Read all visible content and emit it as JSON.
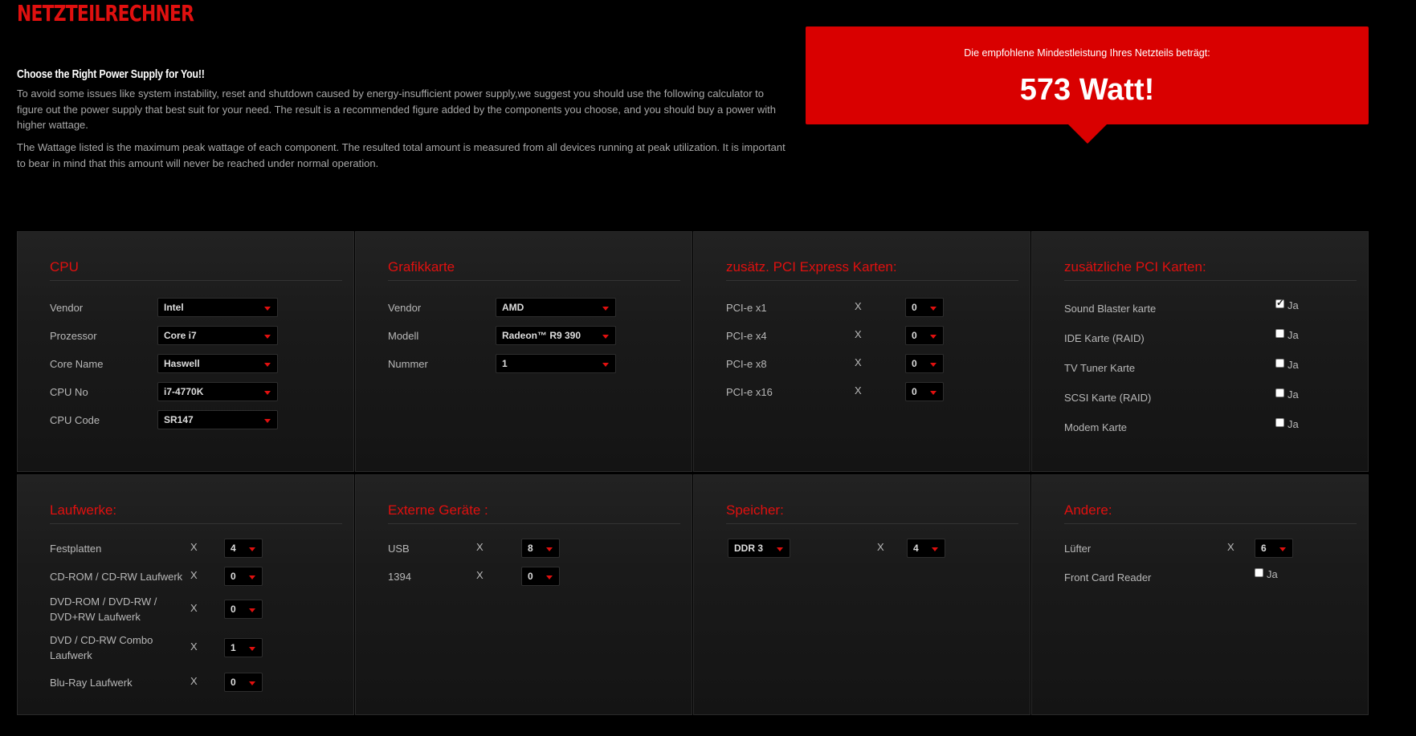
{
  "header": {
    "title": "NETZTEILRECHNER",
    "heading": "Choose the Right Power Supply for You!!",
    "para1": "To avoid some issues like system instability, reset and shutdown caused by energy-insufficient power supply,we suggest you should use the following calculator to figure out the power supply that best suit for your need. The result is a recommended figure added by the components you choose, and you should buy a power with higher wattage.",
    "para2": "The Wattage listed is the maximum peak wattage of each component. The resulted total amount is measured from all devices running at peak utilization. It is important to bear in mind that this amount will never be reached under normal operation."
  },
  "result": {
    "label": "Die empfohlene Mindestleistung Ihres Netzteils beträgt:",
    "value": "573 Watt!"
  },
  "cpu": {
    "title": "CPU",
    "vendor_label": "Vendor",
    "vendor": "Intel",
    "processor_label": "Prozessor",
    "processor": "Core i7",
    "corename_label": "Core Name",
    "corename": "Haswell",
    "cpuno_label": "CPU No",
    "cpuno": "i7-4770K",
    "cpucode_label": "CPU Code",
    "cpucode": "SR147"
  },
  "gpu": {
    "title": "Grafikkarte",
    "vendor_label": "Vendor",
    "vendor": "AMD",
    "model_label": "Modell",
    "model": "Radeon™ R9 390",
    "number_label": "Nummer",
    "number": "1"
  },
  "pcie": {
    "title": "zusätz. PCI Express Karten:",
    "x": "X",
    "x1_label": "PCI-e x1",
    "x1": "0",
    "x4_label": "PCI-e x4",
    "x4": "0",
    "x8_label": "PCI-e x8",
    "x8": "0",
    "x16_label": "PCI-e x16",
    "x16": "0"
  },
  "pci": {
    "title": "zusätzliche PCI Karten:",
    "ja": "Ja",
    "soundblaster_label": "Sound Blaster karte",
    "soundblaster": true,
    "ide_label": "IDE Karte (RAID)",
    "ide": false,
    "tvtuner_label": "TV Tuner Karte",
    "tvtuner": false,
    "scsi_label": "SCSI Karte (RAID)",
    "scsi": false,
    "modem_label": "Modem Karte",
    "modem": false
  },
  "drives": {
    "title": "Laufwerke:",
    "x": "X",
    "hdd_label": "Festplatten",
    "hdd": "4",
    "cdrom_label": "CD-ROM / CD-RW Laufwerk",
    "cdrom": "0",
    "dvdrom_label1": "DVD-ROM / DVD-RW /",
    "dvdrom_label2": "DVD+RW Laufwerk",
    "dvdrom": "0",
    "combo_label1": "DVD / CD-RW Combo",
    "combo_label2": "Laufwerk",
    "combo": "1",
    "bluray_label": "Blu-Ray Laufwerk",
    "bluray": "0"
  },
  "external": {
    "title": "Externe Geräte :",
    "x": "X",
    "usb_label": "USB",
    "usb": "8",
    "fw_label": "1394",
    "fw": "0"
  },
  "memory": {
    "title": "Speicher:",
    "x": "X",
    "type": "DDR 3",
    "count": "4"
  },
  "other": {
    "title": "Andere:",
    "x": "X",
    "ja": "Ja",
    "fans_label": "Lüfter",
    "fans": "6",
    "cardreader_label": "Front Card Reader",
    "cardreader": false
  },
  "colors": {
    "accent": "#e0100f",
    "result_bg": "#d90000",
    "background": "#000000"
  }
}
